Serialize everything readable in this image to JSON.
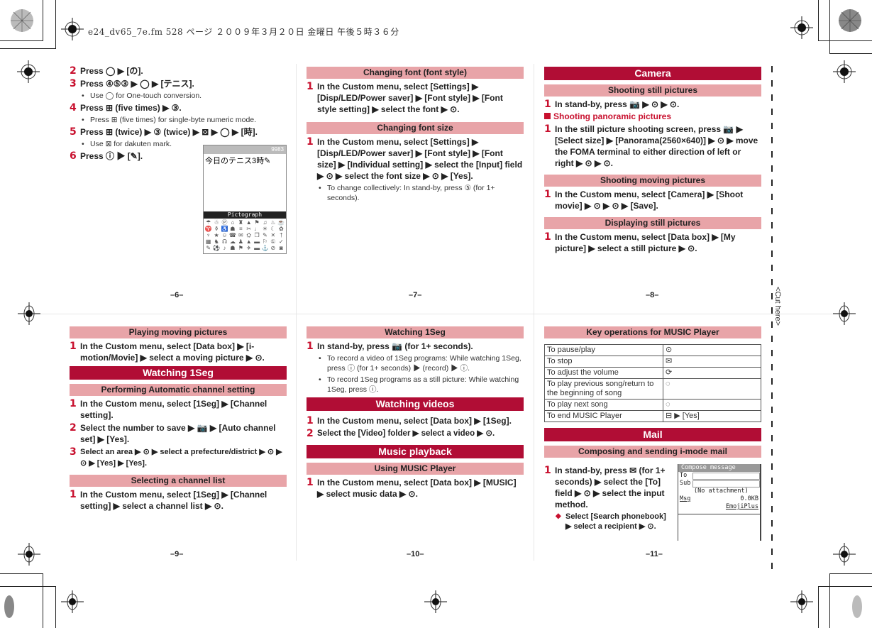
{
  "print_header": "e24_dv65_7e.fm  528 ページ  ２００９年３月２０日  金曜日  午後５時３６分",
  "cut_here": "<Cut here>",
  "pages": {
    "p6": {
      "number": "–6–",
      "steps": [
        {
          "n": "2",
          "text": "Press ◯ ▶ [の]."
        },
        {
          "n": "3",
          "text": "Press ④⑤③ ▶ ◯ ▶ [テニス]."
        },
        {
          "n": "4",
          "text": "Press ⊞ (five times) ▶ ③."
        },
        {
          "n": "5",
          "text": "Press ⊞ (twice) ▶ ③ (twice) ▶ ⊠ ▶ ◯ ▶ [時]."
        },
        {
          "n": "6",
          "text": "Press ⓘ ▶ [✎]."
        }
      ],
      "notes": {
        "step3": "Use ◯ for One-touch conversion.",
        "step4": "Press ⊞ (five times) for single-byte numeric mode.",
        "step5": "Use ⊠ for dakuten mark."
      },
      "screen": {
        "counter": "9983",
        "text": "今日のテニス3時✎",
        "bar_label": "Pictograph"
      }
    },
    "p7": {
      "number": "–7–",
      "sections": [
        {
          "title": "Changing font (font style)",
          "step": "In the Custom menu, select [Settings] ▶ [Disp/LED/Power saver] ▶ [Font style] ▶ [Font style setting] ▶ select the font ▶ ⊙."
        },
        {
          "title": "Changing font size",
          "step": "In the Custom menu, select [Settings] ▶ [Disp/LED/Power saver] ▶ [Font style] ▶ [Font size] ▶ [Individual setting] ▶ select the [Input] field ▶ ⊙ ▶ select the font size ▶ ⊙ ▶ [Yes].",
          "note": "To change collectively: In stand-by, press ⑤ (for 1+ seconds)."
        }
      ]
    },
    "p8": {
      "number": "–8–",
      "main_title": "Camera",
      "s1_title": "Shooting still pictures",
      "s1_step": "In stand-by, press 📷 ▶ ⊙ ▶ ⊙.",
      "sq_title": "Shooting panoramic pictures",
      "sq_step": "In the still picture shooting screen, press 📷 ▶ [Select size] ▶ [Panorama(2560×640)] ▶ ⊙ ▶ move the FOMA terminal to either direction of left or right ▶ ⊙ ▶ ⊙.",
      "s2_title": "Shooting moving pictures",
      "s2_step": "In the Custom menu, select [Camera] ▶ [Shoot movie] ▶ ⊙ ▶ ⊙ ▶ [Save].",
      "s3_title": "Displaying still pictures",
      "s3_step": "In the Custom menu, select [Data box] ▶ [My picture] ▶ select a still picture ▶ ⊙."
    },
    "p9": {
      "number": "–9–",
      "s1_title": "Playing moving pictures",
      "s1_step": "In the Custom menu, select [Data box] ▶ [i-motion/Movie] ▶ select a moving picture ▶ ⊙.",
      "main_title": "Watching 1Seg",
      "s2_title": "Performing Automatic channel setting",
      "s2_steps": [
        {
          "n": "1",
          "text": "In the Custom menu, select [1Seg] ▶ [Channel setting]."
        },
        {
          "n": "2",
          "text": "Select the number to save ▶ 📷 ▶ [Auto channel set] ▶ [Yes]."
        },
        {
          "n": "3",
          "text": "Select an area ▶ ⊙ ▶ select a prefecture/district ▶ ⊙ ▶ ⊙ ▶ [Yes] ▶ [Yes]."
        }
      ],
      "s3_title": "Selecting a channel list",
      "s3_step": "In the Custom menu, select [1Seg] ▶ [Channel setting] ▶ select a channel list ▶ ⊙."
    },
    "p10": {
      "number": "–10–",
      "s1_title": "Watching 1Seg",
      "s1_step": "In stand-by, press 📷 (for 1+ seconds).",
      "s1_notes": [
        "To record a video of 1Seg programs: While watching 1Seg, press ⓘ (for 1+ seconds) ▶ (record) ▶ ⓘ.",
        "To record 1Seg programs as a still picture: While watching 1Seg, press ⓘ."
      ],
      "main2_title": "Watching videos",
      "main2_steps": [
        {
          "n": "1",
          "text": "In the Custom menu, select [Data box] ▶ [1Seg]."
        },
        {
          "n": "2",
          "text": "Select the [Video] folder ▶ select a video ▶ ⊙."
        }
      ],
      "main3_title": "Music playback",
      "s3_title": "Using MUSIC Player",
      "s3_step": "In the Custom menu, select [Data box] ▶ [MUSIC] ▶ select music data ▶ ⊙."
    },
    "p11": {
      "number": "–11–",
      "s1_title": "Key operations for MUSIC Player",
      "table": [
        {
          "action": "To pause/play",
          "key": "⊙"
        },
        {
          "action": "To stop",
          "key": "✉"
        },
        {
          "action": "To adjust the volume",
          "key": "⟳"
        },
        {
          "action": "To play previous song/return to the beginning of song",
          "key": "◌"
        },
        {
          "action": "To play next song",
          "key": "◌"
        },
        {
          "action": "To end MUSIC Player",
          "key": "⊟ ▶ [Yes]"
        }
      ],
      "main_title": "Mail",
      "s2_title": "Composing and sending i-mode mail",
      "s2_step": "In stand-by, press ✉ (for 1+ seconds) ▶ select the [To] field ▶ ⊙ ▶ select the input method.",
      "s2_option": "Select [Search phonebook] ▶ select a recipient ▶ ⊙.",
      "screen": {
        "title": "Compose message",
        "to": "To",
        "sub": "Sub",
        "attach": "(No attachment)",
        "msg": "Msg",
        "size": "0.0KB",
        "emoji": "EmojiPlus"
      }
    }
  }
}
